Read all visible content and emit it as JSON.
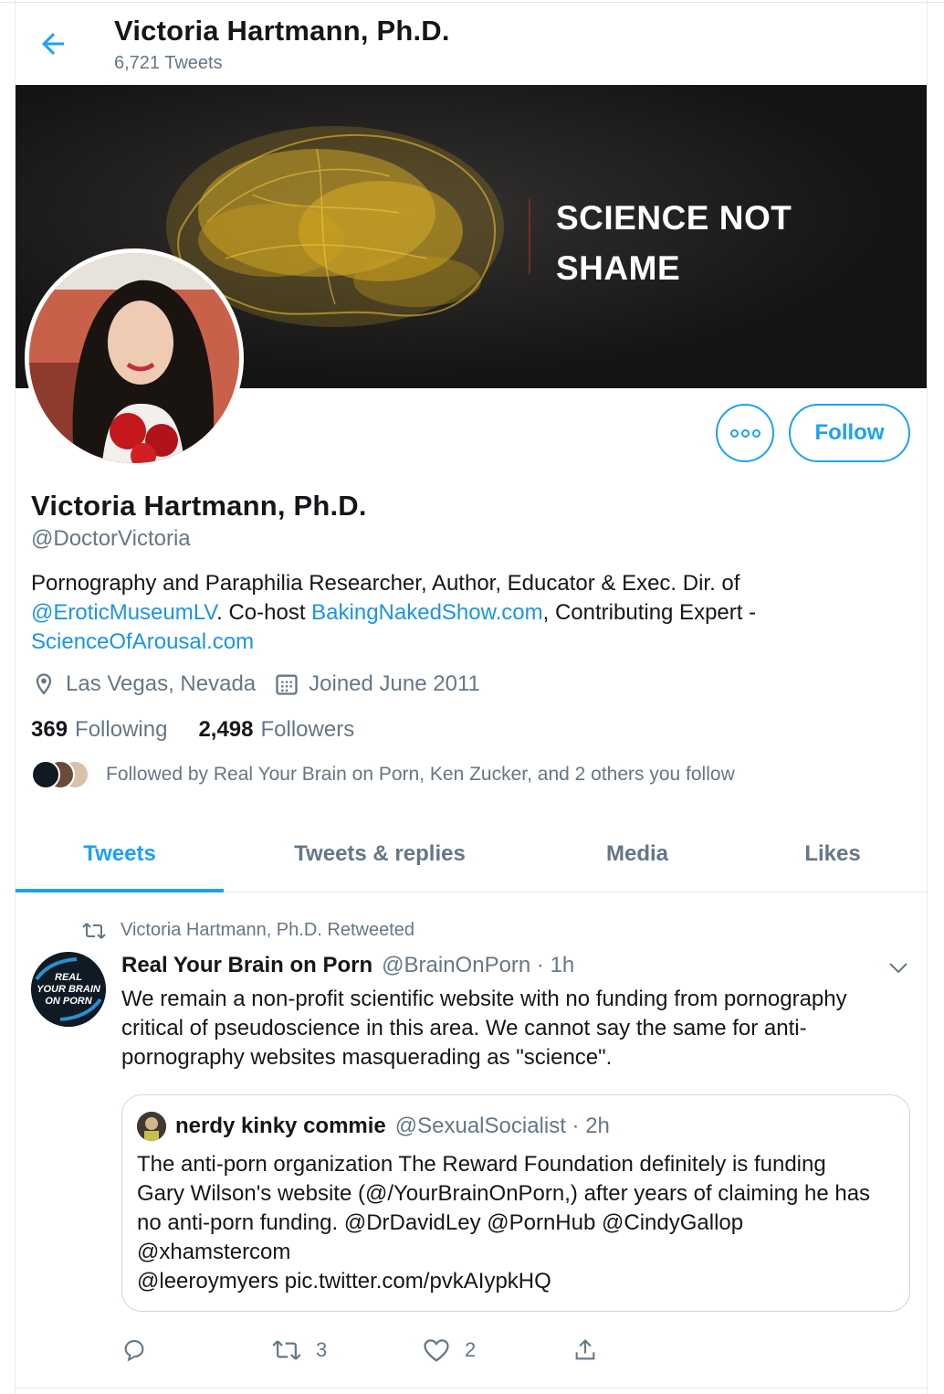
{
  "header": {
    "title": "Victoria Hartmann, Ph.D.",
    "tweet_count": "6,721 Tweets"
  },
  "banner": {
    "line1": "SCIENCE NOT",
    "line2": "SHAME"
  },
  "actions": {
    "follow_label": "Follow"
  },
  "profile": {
    "name": "Victoria Hartmann, Ph.D.",
    "handle": "@DoctorVictoria",
    "bio": {
      "part1": "Pornography and Paraphilia Researcher, Author, Educator & Exec. Dir. of ",
      "link1": "@EroticMuseumLV",
      "part2": ". Co-host ",
      "link2": "BakingNakedShow.com",
      "part3": ", Contributing Expert - ",
      "link3": "ScienceOfArousal.com"
    },
    "location": "Las Vegas, Nevada",
    "joined": "Joined June 2011",
    "following_count": "369",
    "following_label": "Following",
    "followers_count": "2,498",
    "followers_label": "Followers",
    "followed_by": "Followed by Real Your Brain on Porn, Ken Zucker, and 2 others you follow"
  },
  "tabs": [
    {
      "label": "Tweets",
      "active": true
    },
    {
      "label": "Tweets & replies",
      "active": false
    },
    {
      "label": "Media",
      "active": false
    },
    {
      "label": "Likes",
      "active": false
    }
  ],
  "tweet": {
    "retweet_context": "Victoria Hartmann, Ph.D. Retweeted",
    "author_name": "Real Your Brain on Porn",
    "author_meta": "@BrainOnPorn · 1h",
    "avatar_text": [
      "REAL",
      "YOUR BRAIN",
      "ON PORN"
    ],
    "text": "We remain a non-profit scientific website with no funding from pornography critical of pseudoscience in this area. We cannot say the same for anti-pornography websites masquerading as \"science\".",
    "quote": {
      "author_name": "nerdy kinky commie",
      "author_meta": "@SexualSocialist · 2h",
      "line1": "The anti-porn organization The Reward Foundation definitely is funding",
      "line2": "Gary Wilson's website (@/YourBrainOnPorn,) after years of claiming he has",
      "line3": "no anti-porn funding. @DrDavidLey @PornHub @CindyGallop",
      "line4": "@xhamstercom",
      "line5": "@leeroymyers pic.twitter.com/pvkAIypkHQ"
    },
    "retweet_count": "3",
    "like_count": "2"
  },
  "colors": {
    "accent": "#1da1f2",
    "link": "#1b95e0",
    "secondary_text": "#657786",
    "banner_text": "#ffffff"
  }
}
